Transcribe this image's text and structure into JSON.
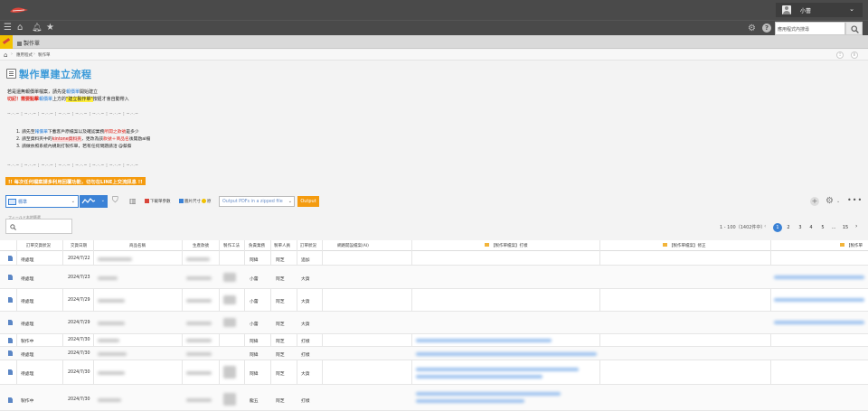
{
  "header": {
    "user_name": "小蕾",
    "search_placeholder": "應用程式內搜尋"
  },
  "tab": {
    "app_name": "製作單"
  },
  "breadcrumb": {
    "items": [
      "應用程式",
      "製作單"
    ]
  },
  "page": {
    "title": "製作單建立流程",
    "intro_line1_a": "若是還無報價單檔案，請先從",
    "intro_line1_link": "報價單",
    "intro_line1_b": "開始建立",
    "intro_line2_a": "切記！需要點擊",
    "intro_line2_link": "報價單",
    "intro_line2_b": "上方的",
    "intro_line2_hl": "\"建立製作單\"",
    "intro_line2_c": "按鈕才會自動帶入",
    "divider": "~.-.~ ¦ ~.-.~ ¦ ~.-.~ ¦ ~.-.~ ¦ ~.-.~ ¦ ~.-.~ ¦ ~.-.~ ¦ ~.-.~",
    "steps": [
      {
        "a": "1. 請先至",
        "link": "報價單",
        "b": "下載客戶原檔案以及確認業務",
        "red": "所開之",
        "c": "款號",
        "d": "是多少"
      },
      {
        "a": "2. 請至資料夾中的",
        "box": "kintone資料夾",
        "b": "，更改為該",
        "red": "款號＋商品名",
        "c": "後開啟ai檔",
        "d": ""
      },
      {
        "a": "3. 請做依照系統內規則打製作單，若有任何問題請洽 @蔡蔡",
        "link": "",
        "b": "",
        "red": "",
        "c": "",
        "d": ""
      }
    ],
    "banner": "!! 每次任何檔案請多利用回覆功能，切勿在LINE上交流訊息 !!"
  },
  "toolbar": {
    "view_label": "標準",
    "btn_download": "下載單參數",
    "btn_size": "圖片尺寸",
    "btn_size_suffix": "原",
    "pdf_select": "Output PDFs in a zipped file",
    "output_label": "Output"
  },
  "filter": {
    "label": "フィールド本地篩選"
  },
  "pagination": {
    "count": "1 - 100（1402件中）",
    "pages": [
      "1",
      "2",
      "3",
      "4",
      "5",
      "...",
      "15"
    ]
  },
  "table": {
    "headers": [
      "訂單交貨狀況",
      "交貨日期",
      "商品名稱",
      "生產款號",
      "製作工法",
      "負責業務",
      "製單人員",
      "訂單狀況",
      "網路開設檔案(AI)",
      "【製作單檔案】打樣",
      "【製作單檔案】修正",
      "【製作單"
    ],
    "rows": [
      {
        "status": "待處理",
        "date": "2024/7/22",
        "sales": "阿緯",
        "maker": "阿芝",
        "order": "追加"
      },
      {
        "status": "待處理",
        "date": "2024/7/23",
        "sales": "小蕾",
        "maker": "阿芝",
        "order": "大貨"
      },
      {
        "status": "待處理",
        "date": "2024/7/29",
        "sales": "小蕾",
        "maker": "阿芝",
        "order": "大貨"
      },
      {
        "status": "待處理",
        "date": "2024/7/29",
        "sales": "小蕾",
        "maker": "阿芝",
        "order": "大貨"
      },
      {
        "status": "製作中",
        "date": "2024/7/30",
        "sales": "阿緯",
        "maker": "阿芝",
        "order": "打樣"
      },
      {
        "status": "待處理",
        "date": "2024/7/30",
        "sales": "阿緯",
        "maker": "阿芝",
        "order": "打樣"
      },
      {
        "status": "待處理",
        "date": "2024/7/30",
        "sales": "阿緯",
        "maker": "阿芝",
        "order": "大貨"
      },
      {
        "status": "製作中",
        "date": "2024/7/30",
        "sales": "龍五",
        "maker": "阿芝",
        "order": "打樣"
      }
    ]
  },
  "colors": {
    "accent": "#3b82d6",
    "orange": "#f49b0f",
    "title_blue": "#3a9ad9"
  }
}
